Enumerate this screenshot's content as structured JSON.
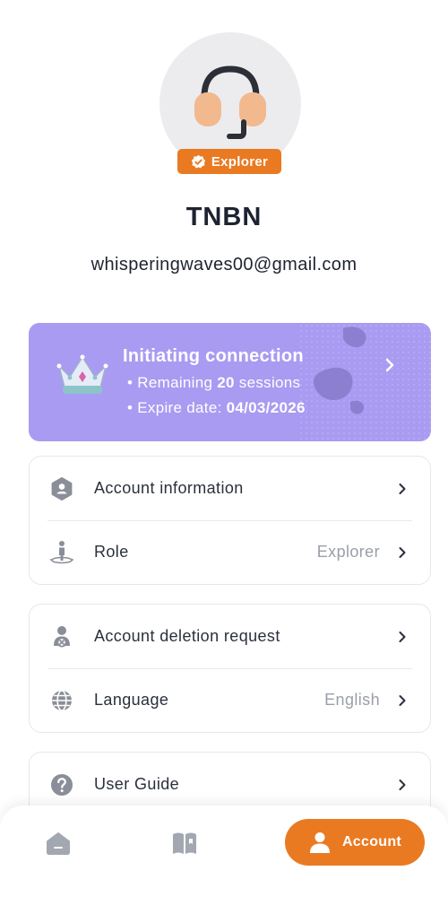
{
  "profile": {
    "badge_label": "Explorer",
    "username": "TNBN",
    "email": "whisperingwaves00@gmail.com"
  },
  "subscription": {
    "title": "Initiating connection",
    "remaining_prefix": "• Remaining ",
    "remaining_count": "20",
    "remaining_suffix": " sessions",
    "expire_prefix": "• Expire date: ",
    "expire_date": "04/03/2026"
  },
  "menu_groups": [
    {
      "items": [
        {
          "label": "Account information",
          "value": "",
          "icon": "account-info-icon"
        },
        {
          "label": "Role",
          "value": "Explorer",
          "icon": "role-icon"
        }
      ]
    },
    {
      "items": [
        {
          "label": "Account deletion request",
          "value": "",
          "icon": "delete-account-icon"
        },
        {
          "label": "Language",
          "value": "English",
          "icon": "globe-icon"
        }
      ]
    },
    {
      "items": [
        {
          "label": "User Guide",
          "value": "",
          "icon": "help-icon"
        }
      ]
    }
  ],
  "bottom_nav": {
    "items": [
      {
        "label": "",
        "icon": "home-icon"
      },
      {
        "label": "",
        "icon": "book-icon"
      },
      {
        "label": "Account",
        "icon": "user-icon",
        "active": true
      }
    ]
  },
  "colors": {
    "accent": "#ea7a21",
    "promo_bg": "#a99bf2",
    "icon_gray": "#8a8e99",
    "text_dark": "#1d2330",
    "text_muted": "#9a9ea8"
  }
}
